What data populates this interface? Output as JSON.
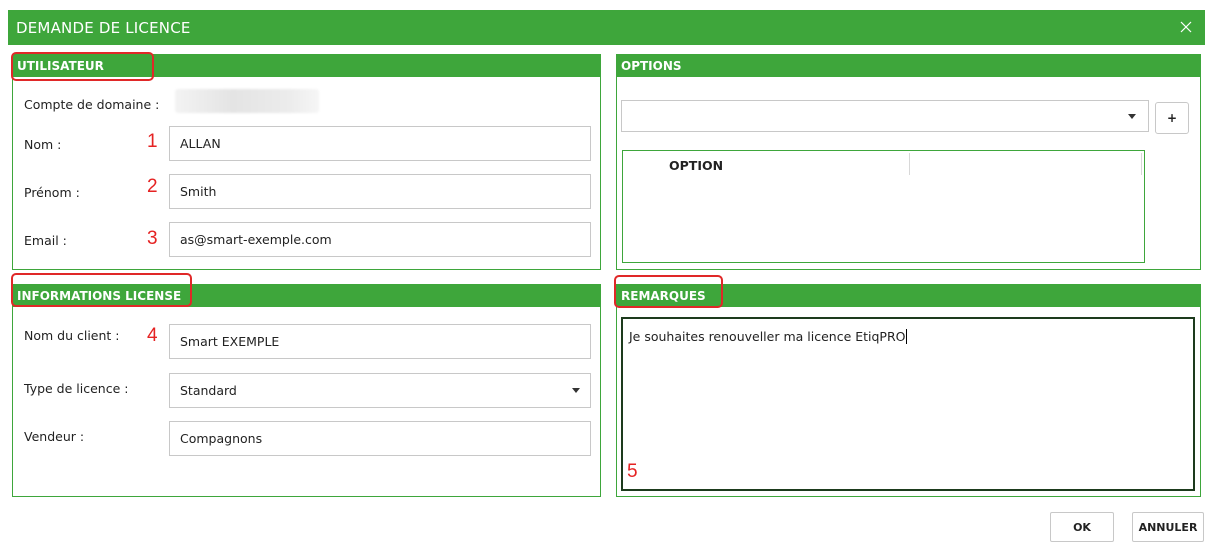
{
  "window": {
    "title": "DEMANDE DE LICENCE",
    "close_icon": "close-icon"
  },
  "user": {
    "header": "UTILISATEUR",
    "domain_label": "Compte de domaine :",
    "nom_label": "Nom :",
    "nom_value": "ALLAN",
    "prenom_label": "Prénom :",
    "prenom_value": "Smith",
    "email_label": "Email :",
    "email_value": "as@smart-exemple.com"
  },
  "options": {
    "header": "OPTIONS",
    "select_value": "",
    "add_label": "+",
    "grid_column": "OPTION"
  },
  "license": {
    "header": "INFORMATIONS LICENSE",
    "client_label": "Nom du client :",
    "client_value": "Smart EXEMPLE",
    "type_label": "Type de licence :",
    "type_value": "Standard",
    "vendeur_label": "Vendeur :",
    "vendeur_value": "Compagnons"
  },
  "remarks": {
    "header": "REMARQUES",
    "text": "Je souhaites renouveller ma licence EtiqPRO"
  },
  "annotations": {
    "n1": "1",
    "n2": "2",
    "n3": "3",
    "n4": "4",
    "n5": "5"
  },
  "buttons": {
    "ok": "OK",
    "cancel": "ANNULER"
  },
  "colors": {
    "accent": "#3ea63b",
    "highlight": "#e02828",
    "annotation": "#e52222"
  }
}
